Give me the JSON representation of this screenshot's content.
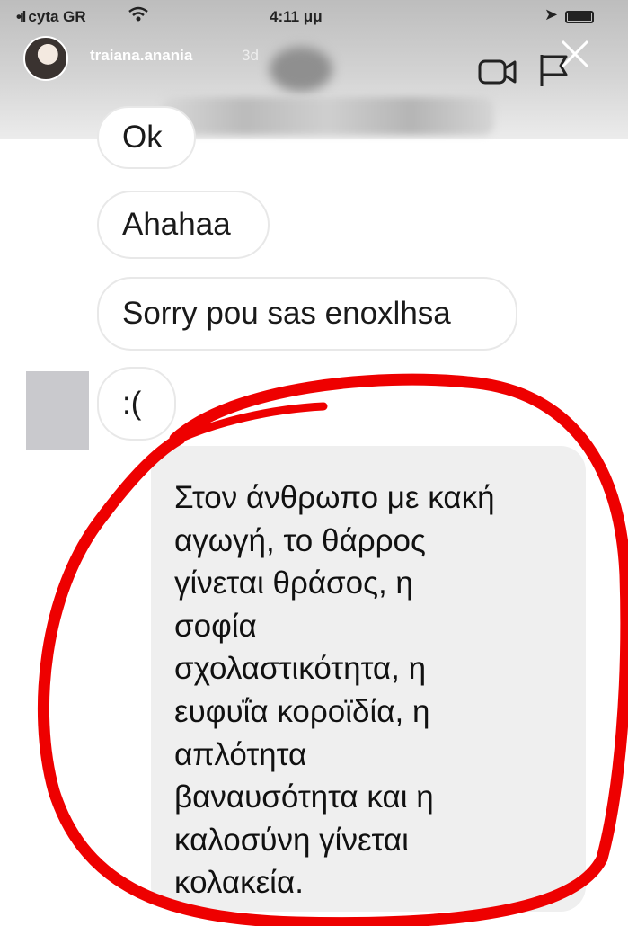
{
  "status_bar": {
    "carrier": "cyta GR",
    "time": "4:11 μμ"
  },
  "story_header": {
    "username": "traiana.anania",
    "time_ago": "3d"
  },
  "messages": [
    {
      "text": "Ok"
    },
    {
      "text": "Ahahaa"
    },
    {
      "text": "Sorry pou sas enoxlhsa"
    },
    {
      "text": ":("
    }
  ],
  "reply": {
    "text": "Στον άνθρωπο με κακή\nαγωγή, το θάρρος\nγίνεται θράσος, η\nσοφία\nσχολαστικότητα, η\nευφυΐα κοροϊδία, η\nαπλότητα\nβαναυσότητα και η\nκαλοσύνη γίνεται\nκολακεία."
  },
  "annotation_color": "#ee0000",
  "icons": [
    "video-call-icon",
    "flag-icon",
    "close-icon",
    "wifi-icon",
    "location-arrow-icon",
    "battery-icon"
  ]
}
